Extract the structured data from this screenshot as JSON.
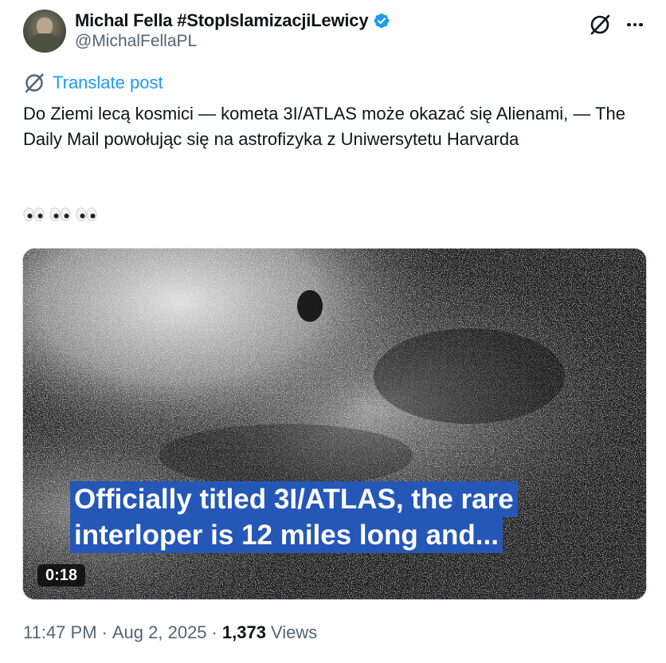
{
  "post": {
    "author": {
      "display_name": "Michal Fella #StopIslamizacjiLewicy",
      "handle": "@MichalFellaPL",
      "verified": true,
      "verified_color": "#1d9bf0"
    },
    "header_icons": [
      "grok-icon",
      "more-icon"
    ],
    "translate_label": "Translate post",
    "text": "Do Ziemi lecą kosmici — kometa 3I/ATLAS może okazać się Alienami, — The Daily Mail powołując się na astrofizyka z Uniwersytetu Harvarda",
    "emoji_line": "👀👀👀",
    "media": {
      "type": "video",
      "caption_lines": [
        "Officially titled 3I/ATLAS, the rare",
        "interloper is 12 miles long and..."
      ],
      "duration": "0:18",
      "caption_bg_color": "#2557b7"
    },
    "meta": {
      "time": "11:47 PM",
      "date": "Aug 2, 2025",
      "separator": "·",
      "views_count": "1,373",
      "views_label": "Views"
    }
  },
  "colors": {
    "link": "#1d9bf0",
    "secondary_text": "#536471",
    "primary_text": "#0f1419"
  }
}
